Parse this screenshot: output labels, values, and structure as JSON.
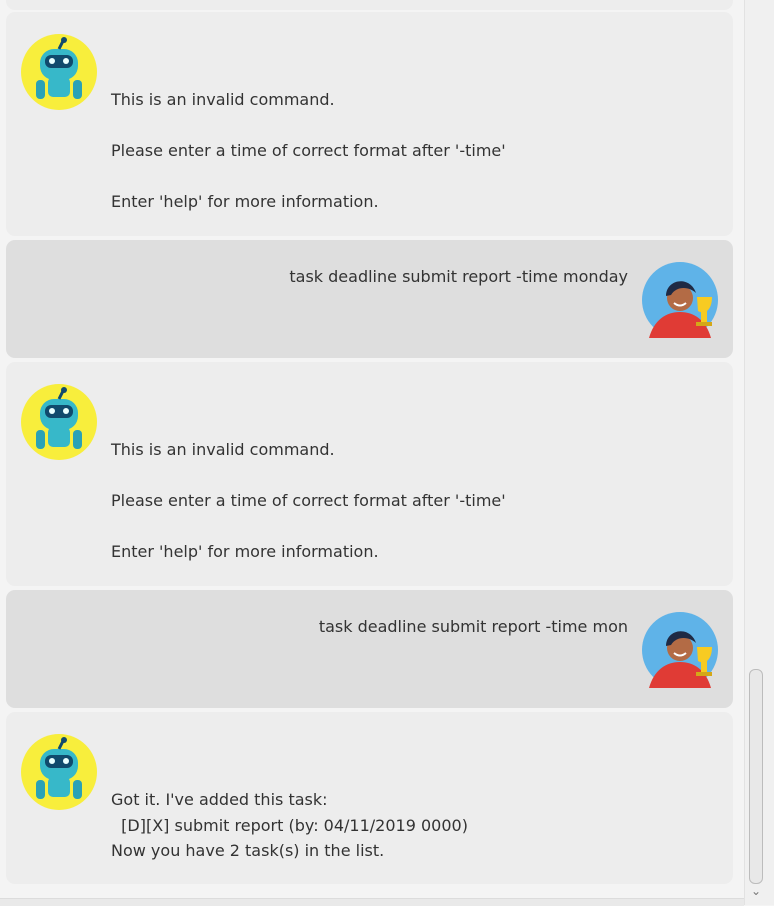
{
  "messages": [
    {
      "speaker": "bot",
      "text": "This is an invalid command.\n\nPlease enter a time of correct format after '-time'\n\nEnter 'help' for more information."
    },
    {
      "speaker": "user",
      "text": "task deadline submit report -time monday"
    },
    {
      "speaker": "bot",
      "text": "This is an invalid command.\n\nPlease enter a time of correct format after '-time'\n\nEnter 'help' for more information."
    },
    {
      "speaker": "user",
      "text": "task deadline submit report -time mon"
    },
    {
      "speaker": "bot",
      "text": "Got it. I've added this task:\n  [D][X] submit report (by: 04/11/2019 0000)\nNow you have 2 task(s) in the list."
    }
  ],
  "icons": {
    "bot_avatar": "robot-avatar-icon",
    "user_avatar": "user-avatar-icon",
    "scroll_down": "chevron-down-icon"
  },
  "colors": {
    "bot_bubble": "#ededed",
    "user_bubble": "#dedede",
    "bot_avatar_bg": "#f8ee3c",
    "user_avatar_bg": "#5fb3e8"
  },
  "scrollbar": {
    "position_fraction": 0.96
  }
}
